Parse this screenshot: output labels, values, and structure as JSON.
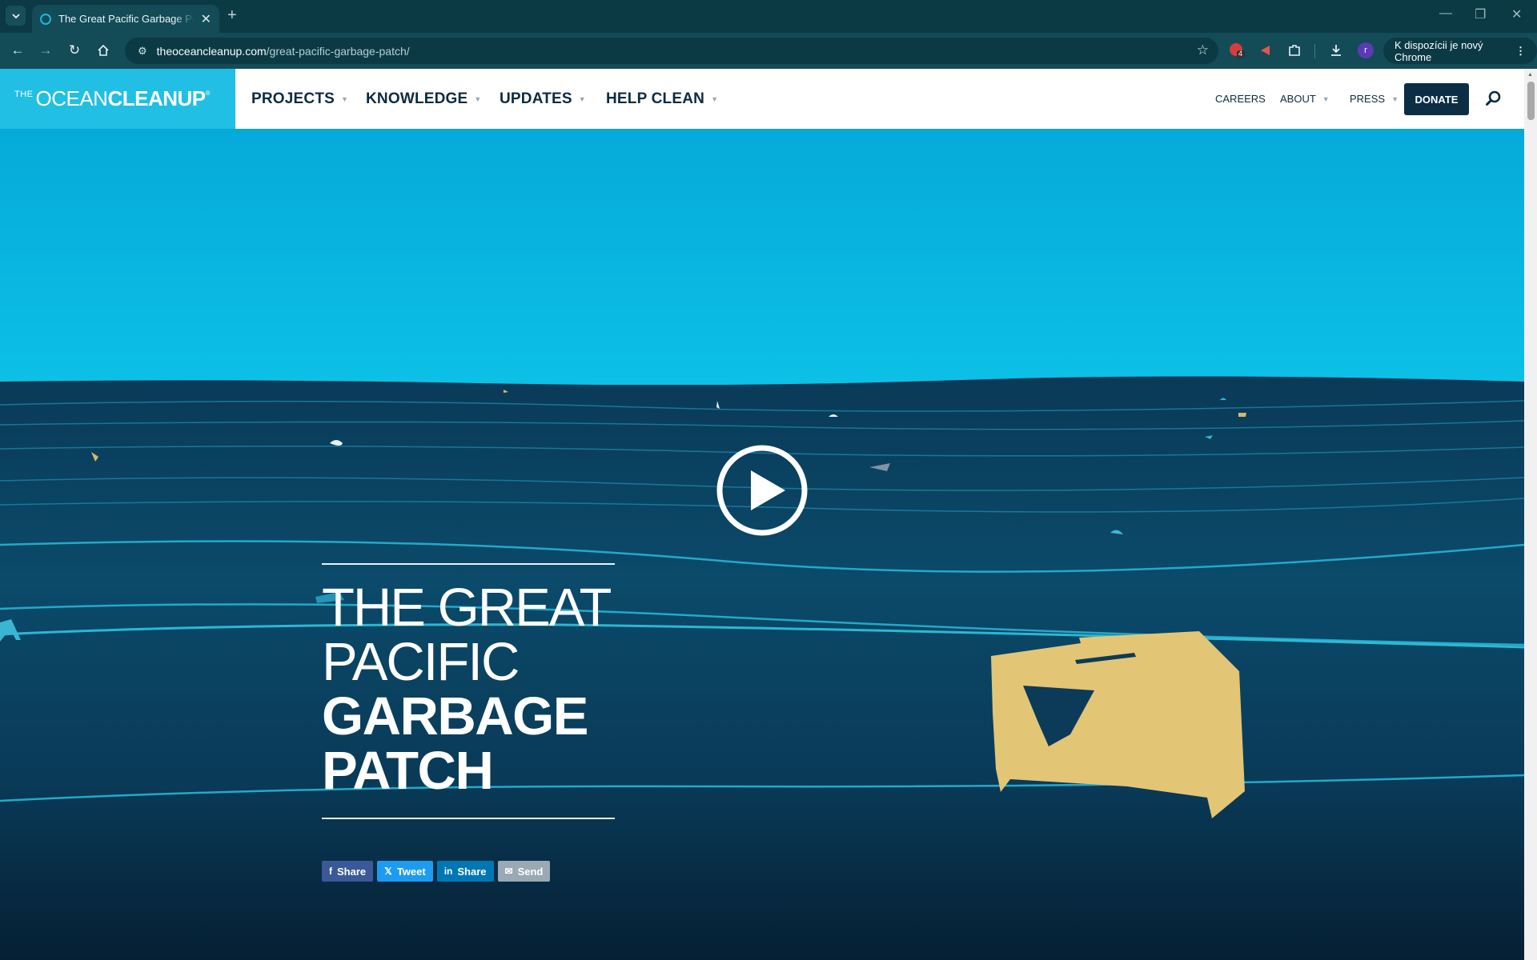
{
  "browser": {
    "tab_title": "The Great Pacific Garbage Patch",
    "url_host": "theoceancleanup.com",
    "url_path": "/great-pacific-garbage-patch/",
    "update_chip": "K dispozícii je nový Chrome",
    "profile_initial": "r",
    "extension_badge": "4"
  },
  "site": {
    "logo": {
      "the": "THE",
      "ocean": "OCEAN",
      "cleanup": "CLEANUP",
      "reg": "®"
    },
    "main_nav": [
      "PROJECTS",
      "KNOWLEDGE",
      "UPDATES",
      "HELP CLEAN"
    ],
    "sub_nav": {
      "careers": "CAREERS",
      "about": "ABOUT",
      "press": "PRESS"
    },
    "donate": "DONATE"
  },
  "hero": {
    "headline_light_1": "THE GREAT",
    "headline_light_2": "PACIFIC",
    "headline_bold_1": "GARBAGE",
    "headline_bold_2": "PATCH",
    "share": {
      "facebook": "Share",
      "twitter": "Tweet",
      "linkedin": "Share",
      "email": "Send"
    }
  },
  "colors": {
    "sky": "#06b3df",
    "ocean_dark": "#0a2c45",
    "brand_cyan": "#21bfe3",
    "navy": "#0b2e45",
    "facebook": "#3b5998",
    "twitter": "#1d9bf0",
    "linkedin": "#0077b5",
    "email": "#9aa9b3",
    "debris": "#e5c574"
  }
}
